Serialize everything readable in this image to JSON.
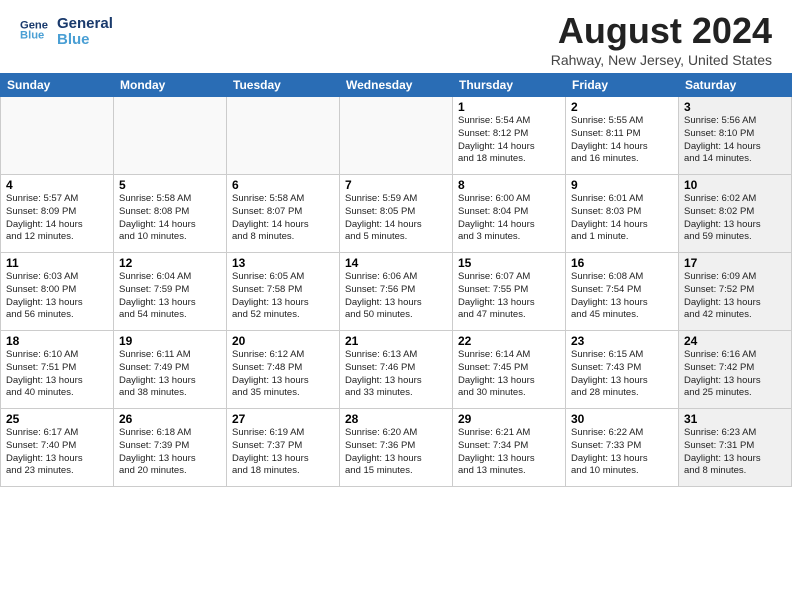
{
  "header": {
    "logo_line1": "General",
    "logo_line2": "Blue",
    "main_title": "August 2024",
    "subtitle": "Rahway, New Jersey, United States"
  },
  "calendar": {
    "days_of_week": [
      "Sunday",
      "Monday",
      "Tuesday",
      "Wednesday",
      "Thursday",
      "Friday",
      "Saturday"
    ],
    "weeks": [
      [
        {
          "day": "",
          "info": "",
          "empty": true
        },
        {
          "day": "",
          "info": "",
          "empty": true
        },
        {
          "day": "",
          "info": "",
          "empty": true
        },
        {
          "day": "",
          "info": "",
          "empty": true
        },
        {
          "day": "1",
          "info": "Sunrise: 5:54 AM\nSunset: 8:12 PM\nDaylight: 14 hours\nand 18 minutes.",
          "empty": false
        },
        {
          "day": "2",
          "info": "Sunrise: 5:55 AM\nSunset: 8:11 PM\nDaylight: 14 hours\nand 16 minutes.",
          "empty": false
        },
        {
          "day": "3",
          "info": "Sunrise: 5:56 AM\nSunset: 8:10 PM\nDaylight: 14 hours\nand 14 minutes.",
          "empty": false,
          "shaded": true
        }
      ],
      [
        {
          "day": "4",
          "info": "Sunrise: 5:57 AM\nSunset: 8:09 PM\nDaylight: 14 hours\nand 12 minutes.",
          "empty": false
        },
        {
          "day": "5",
          "info": "Sunrise: 5:58 AM\nSunset: 8:08 PM\nDaylight: 14 hours\nand 10 minutes.",
          "empty": false
        },
        {
          "day": "6",
          "info": "Sunrise: 5:58 AM\nSunset: 8:07 PM\nDaylight: 14 hours\nand 8 minutes.",
          "empty": false
        },
        {
          "day": "7",
          "info": "Sunrise: 5:59 AM\nSunset: 8:05 PM\nDaylight: 14 hours\nand 5 minutes.",
          "empty": false
        },
        {
          "day": "8",
          "info": "Sunrise: 6:00 AM\nSunset: 8:04 PM\nDaylight: 14 hours\nand 3 minutes.",
          "empty": false
        },
        {
          "day": "9",
          "info": "Sunrise: 6:01 AM\nSunset: 8:03 PM\nDaylight: 14 hours\nand 1 minute.",
          "empty": false
        },
        {
          "day": "10",
          "info": "Sunrise: 6:02 AM\nSunset: 8:02 PM\nDaylight: 13 hours\nand 59 minutes.",
          "empty": false,
          "shaded": true
        }
      ],
      [
        {
          "day": "11",
          "info": "Sunrise: 6:03 AM\nSunset: 8:00 PM\nDaylight: 13 hours\nand 56 minutes.",
          "empty": false
        },
        {
          "day": "12",
          "info": "Sunrise: 6:04 AM\nSunset: 7:59 PM\nDaylight: 13 hours\nand 54 minutes.",
          "empty": false
        },
        {
          "day": "13",
          "info": "Sunrise: 6:05 AM\nSunset: 7:58 PM\nDaylight: 13 hours\nand 52 minutes.",
          "empty": false
        },
        {
          "day": "14",
          "info": "Sunrise: 6:06 AM\nSunset: 7:56 PM\nDaylight: 13 hours\nand 50 minutes.",
          "empty": false
        },
        {
          "day": "15",
          "info": "Sunrise: 6:07 AM\nSunset: 7:55 PM\nDaylight: 13 hours\nand 47 minutes.",
          "empty": false
        },
        {
          "day": "16",
          "info": "Sunrise: 6:08 AM\nSunset: 7:54 PM\nDaylight: 13 hours\nand 45 minutes.",
          "empty": false
        },
        {
          "day": "17",
          "info": "Sunrise: 6:09 AM\nSunset: 7:52 PM\nDaylight: 13 hours\nand 42 minutes.",
          "empty": false,
          "shaded": true
        }
      ],
      [
        {
          "day": "18",
          "info": "Sunrise: 6:10 AM\nSunset: 7:51 PM\nDaylight: 13 hours\nand 40 minutes.",
          "empty": false
        },
        {
          "day": "19",
          "info": "Sunrise: 6:11 AM\nSunset: 7:49 PM\nDaylight: 13 hours\nand 38 minutes.",
          "empty": false
        },
        {
          "day": "20",
          "info": "Sunrise: 6:12 AM\nSunset: 7:48 PM\nDaylight: 13 hours\nand 35 minutes.",
          "empty": false
        },
        {
          "day": "21",
          "info": "Sunrise: 6:13 AM\nSunset: 7:46 PM\nDaylight: 13 hours\nand 33 minutes.",
          "empty": false
        },
        {
          "day": "22",
          "info": "Sunrise: 6:14 AM\nSunset: 7:45 PM\nDaylight: 13 hours\nand 30 minutes.",
          "empty": false
        },
        {
          "day": "23",
          "info": "Sunrise: 6:15 AM\nSunset: 7:43 PM\nDaylight: 13 hours\nand 28 minutes.",
          "empty": false
        },
        {
          "day": "24",
          "info": "Sunrise: 6:16 AM\nSunset: 7:42 PM\nDaylight: 13 hours\nand 25 minutes.",
          "empty": false,
          "shaded": true
        }
      ],
      [
        {
          "day": "25",
          "info": "Sunrise: 6:17 AM\nSunset: 7:40 PM\nDaylight: 13 hours\nand 23 minutes.",
          "empty": false
        },
        {
          "day": "26",
          "info": "Sunrise: 6:18 AM\nSunset: 7:39 PM\nDaylight: 13 hours\nand 20 minutes.",
          "empty": false
        },
        {
          "day": "27",
          "info": "Sunrise: 6:19 AM\nSunset: 7:37 PM\nDaylight: 13 hours\nand 18 minutes.",
          "empty": false
        },
        {
          "day": "28",
          "info": "Sunrise: 6:20 AM\nSunset: 7:36 PM\nDaylight: 13 hours\nand 15 minutes.",
          "empty": false
        },
        {
          "day": "29",
          "info": "Sunrise: 6:21 AM\nSunset: 7:34 PM\nDaylight: 13 hours\nand 13 minutes.",
          "empty": false
        },
        {
          "day": "30",
          "info": "Sunrise: 6:22 AM\nSunset: 7:33 PM\nDaylight: 13 hours\nand 10 minutes.",
          "empty": false
        },
        {
          "day": "31",
          "info": "Sunrise: 6:23 AM\nSunset: 7:31 PM\nDaylight: 13 hours\nand 8 minutes.",
          "empty": false,
          "shaded": true
        }
      ]
    ]
  }
}
